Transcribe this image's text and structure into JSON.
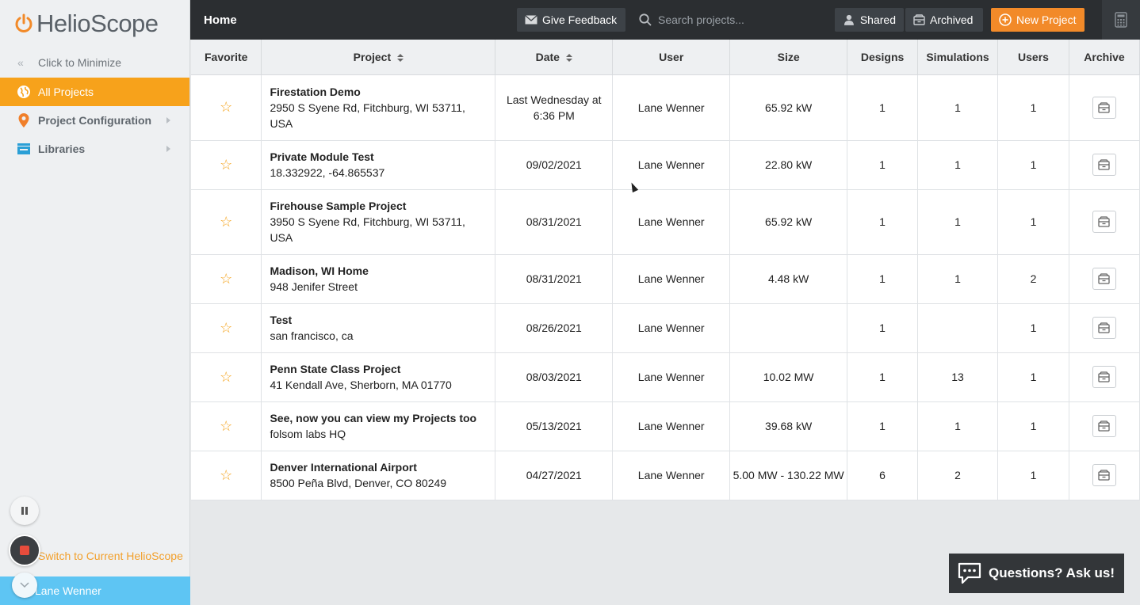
{
  "app": {
    "name": "HelioScope"
  },
  "sidebar": {
    "minimize_label": "Click to Minimize",
    "items": [
      {
        "label": "All Projects",
        "icon": "globe-icon",
        "active": true
      },
      {
        "label": "Project Configuration",
        "icon": "map-pin-icon",
        "active": false
      },
      {
        "label": "Libraries",
        "icon": "library-icon",
        "active": false
      }
    ],
    "switch_link": "Switch to Current HelioScope",
    "user_name": "Lane Wenner"
  },
  "topbar": {
    "title": "Home",
    "feedback_label": "Give Feedback",
    "search_placeholder": "Search projects...",
    "shared_label": "Shared",
    "archived_label": "Archived",
    "new_project_label": "New Project"
  },
  "table": {
    "headers": {
      "favorite": "Favorite",
      "project": "Project",
      "date": "Date",
      "user": "User",
      "size": "Size",
      "designs": "Designs",
      "simulations": "Simulations",
      "users": "Users",
      "archive": "Archive"
    },
    "rows": [
      {
        "name": "Firestation Demo",
        "address": "2950 S Syene Rd, Fitchburg, WI 53711, USA",
        "date": "Last Wednesday at 6:36 PM",
        "user": "Lane Wenner",
        "size": "65.92 kW",
        "designs": "1",
        "simulations": "1",
        "users": "1"
      },
      {
        "name": "Private Module Test",
        "address": "18.332922, -64.865537",
        "date": "09/02/2021",
        "user": "Lane Wenner",
        "size": "22.80 kW",
        "designs": "1",
        "simulations": "1",
        "users": "1"
      },
      {
        "name": "Firehouse Sample Project",
        "address": "3950 S Syene Rd, Fitchburg, WI 53711, USA",
        "date": "08/31/2021",
        "user": "Lane Wenner",
        "size": "65.92 kW",
        "designs": "1",
        "simulations": "1",
        "users": "1"
      },
      {
        "name": "Madison, WI Home",
        "address": "948 Jenifer Street",
        "date": "08/31/2021",
        "user": "Lane Wenner",
        "size": "4.48 kW",
        "designs": "1",
        "simulations": "1",
        "users": "2"
      },
      {
        "name": "Test",
        "address": "san francisco, ca",
        "date": "08/26/2021",
        "user": "Lane Wenner",
        "size": "",
        "designs": "1",
        "simulations": "",
        "users": "1"
      },
      {
        "name": "Penn State Class Project",
        "address": "41 Kendall Ave, Sherborn, MA 01770",
        "date": "08/03/2021",
        "user": "Lane Wenner",
        "size": "10.02 MW",
        "designs": "1",
        "simulations": "13",
        "users": "1"
      },
      {
        "name": "See, now you can view my Projects too",
        "address": "folsom labs HQ",
        "date": "05/13/2021",
        "user": "Lane Wenner",
        "size": "39.68 kW",
        "designs": "1",
        "simulations": "1",
        "users": "1"
      },
      {
        "name": "Denver International Airport",
        "address": "8500 Peña Blvd, Denver, CO 80249",
        "date": "04/27/2021",
        "user": "Lane Wenner",
        "size": "5.00 MW - 130.22 MW",
        "designs": "6",
        "simulations": "2",
        "users": "1"
      }
    ]
  },
  "chat": {
    "label": "Questions? Ask us!"
  },
  "colors": {
    "accent": "#f7a21b",
    "new_project": "#f28a29",
    "user_bar": "#5ec5f3",
    "topbar": "#2b2e31"
  }
}
